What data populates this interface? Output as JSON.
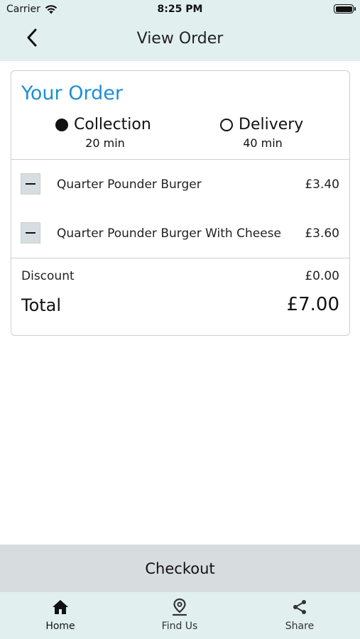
{
  "status_bar": {
    "carrier": "Carrier",
    "time": "8:25 PM"
  },
  "nav": {
    "title": "View Order",
    "back_icon": "chevron-left-icon"
  },
  "order": {
    "heading": "Your Order",
    "heading_color": "#1d8fd6",
    "options": [
      {
        "label": "Collection",
        "time": "20 min",
        "selected": true
      },
      {
        "label": "Delivery",
        "time": "40 min",
        "selected": false
      }
    ],
    "items": [
      {
        "name": "Quarter Pounder Burger",
        "price": "£3.40"
      },
      {
        "name": "Quarter Pounder Burger With Cheese",
        "price": "£3.60"
      }
    ],
    "discount_label": "Discount",
    "discount_value": "£0.00",
    "total_label": "Total",
    "total_value": "£7.00"
  },
  "checkout_label": "Checkout",
  "tabs": [
    {
      "label": "Home",
      "icon": "home-icon",
      "active": true
    },
    {
      "label": "Find Us",
      "icon": "location-pin-icon",
      "active": false
    },
    {
      "label": "Share",
      "icon": "share-icon",
      "active": false
    }
  ],
  "colors": {
    "bar_bg": "#e1efef",
    "checkout_bg": "#d7dcdf"
  }
}
